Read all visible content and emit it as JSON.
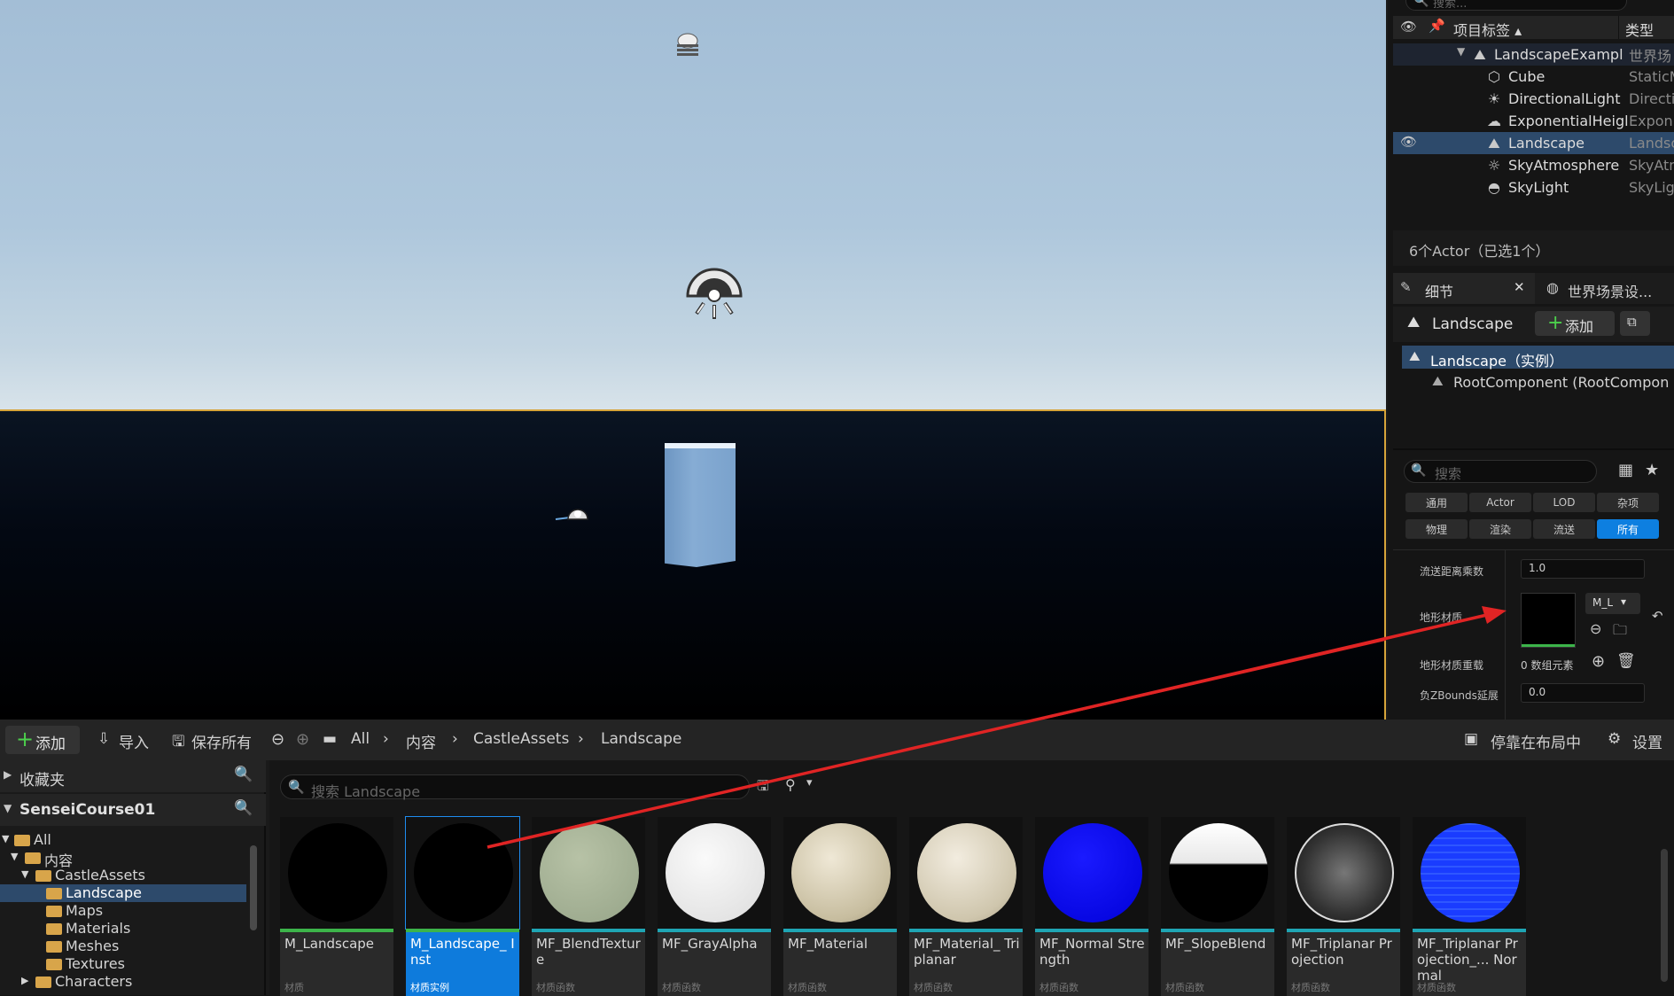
{
  "outliner": {
    "search_placeholder": "搜索...",
    "col_label": "项目标签 ▴",
    "col_type": "类型",
    "rows": [
      {
        "name": "LandscapeExampl",
        "type": "世界场",
        "icon": "world-landscape-icon"
      },
      {
        "name": "Cube",
        "type": "StaticM",
        "icon": "static-mesh-icon"
      },
      {
        "name": "DirectionalLight",
        "type": "Directi",
        "icon": "directional-light-icon"
      },
      {
        "name": "ExponentialHeigl",
        "type": "Expon",
        "icon": "fog-icon"
      },
      {
        "name": "Landscape",
        "type": "Landsc",
        "icon": "landscape-icon"
      },
      {
        "name": "SkyAtmosphere",
        "type": "SkyAtn",
        "icon": "sky-atmosphere-icon"
      },
      {
        "name": "SkyLight",
        "type": "SkyLig",
        "icon": "sky-light-icon"
      }
    ],
    "actor_count": "6个Actor（已选1个）"
  },
  "details": {
    "tab_details": "细节",
    "tab_world": "世界场景设...",
    "actor_name": "Landscape",
    "add_label": "添加",
    "instance_label": "Landscape（实例）",
    "root_component": "RootComponent (RootCompon",
    "search_placeholder": "搜索",
    "categories": [
      "通用",
      "Actor",
      "LOD",
      "杂项",
      "物理",
      "渲染",
      "流送",
      "所有"
    ],
    "props": {
      "stream_dist_label": "流送距离乘数",
      "stream_dist_value": "1.0",
      "material_label": "地形材质",
      "material_value": "M_L",
      "override_label": "地形材质重载",
      "override_value": "0 数组元素",
      "zbounds_label": "负ZBounds延展",
      "zbounds_value": "0.0"
    }
  },
  "content_browser": {
    "toolbar": {
      "add": "添加",
      "import": "导入",
      "save_all": "保存所有",
      "crumbs": [
        "All",
        "内容",
        "CastleAssets",
        "Landscape"
      ],
      "dock": "停靠在布局中",
      "settings": "设置"
    },
    "favorites": "收藏夹",
    "project": "SenseiCourse01",
    "tree": [
      "All",
      "内容",
      "CastleAssets",
      "Landscape",
      "Maps",
      "Materials",
      "Meshes",
      "Textures",
      "Characters"
    ],
    "search_placeholder": "搜索 Landscape",
    "assets": [
      {
        "name": "M_Landscape",
        "type": "材质"
      },
      {
        "name": "M_Landscape_ Inst",
        "type": "材质实例"
      },
      {
        "name": "MF_BlendTexture",
        "type": "材质函数"
      },
      {
        "name": "MF_GrayAlpha",
        "type": "材质函数"
      },
      {
        "name": "MF_Material",
        "type": "材质函数"
      },
      {
        "name": "MF_Material_ Triplanar",
        "type": "材质函数"
      },
      {
        "name": "MF_Normal Strength",
        "type": "材质函数"
      },
      {
        "name": "MF_SlopeBlend",
        "type": "材质函数"
      },
      {
        "name": "MF_Triplanar Projection",
        "type": "材质函数"
      },
      {
        "name": "MF_Triplanar Projection_... Normal",
        "type": "材质函数"
      }
    ]
  },
  "colors": {
    "accent": "#0e7bdc",
    "selection": "#2d4a6b",
    "annotation_arrow": "#e02424",
    "selection_outline": "#d7a43a"
  }
}
